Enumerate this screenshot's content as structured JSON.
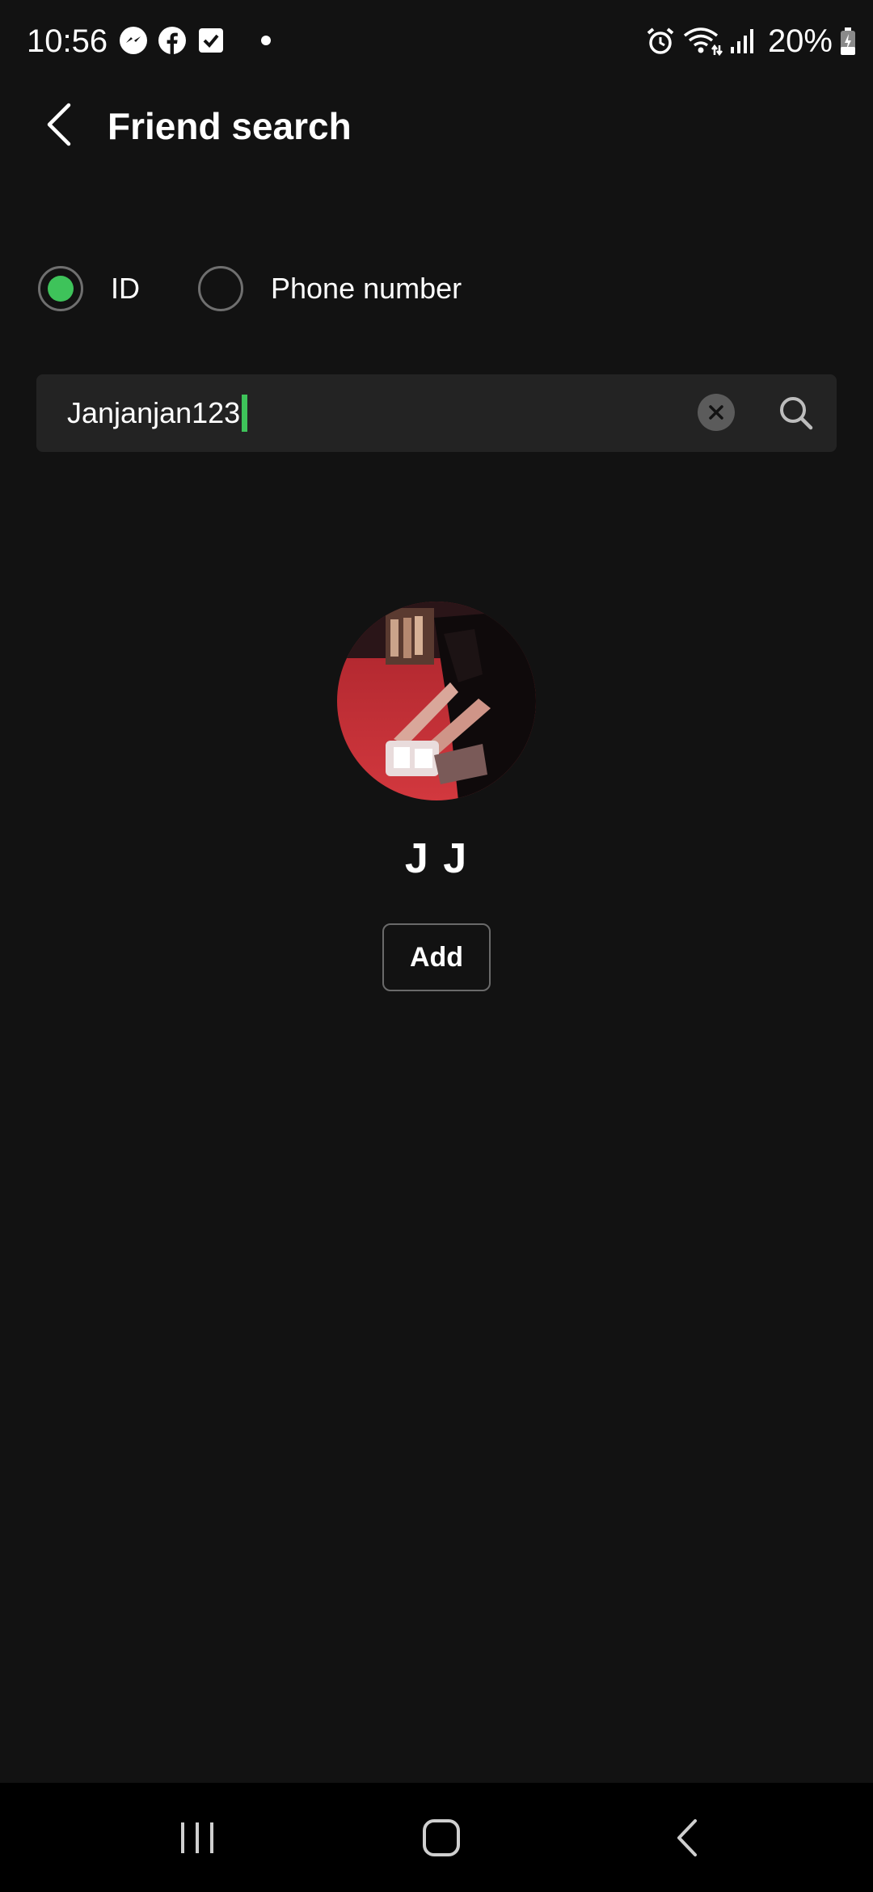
{
  "status_bar": {
    "time": "10:56",
    "left_icons": [
      "messenger-icon",
      "facebook-icon",
      "check-box-icon",
      "notification-dot-icon"
    ],
    "right_icons": [
      "alarm-icon",
      "wifi-icon",
      "signal-icon",
      "battery-charging-icon"
    ],
    "battery": "20%"
  },
  "header": {
    "title": "Friend search",
    "back_icon": "chevron-left-icon"
  },
  "search_type": {
    "options": [
      {
        "label": "ID",
        "selected": true
      },
      {
        "label": "Phone number",
        "selected": false
      }
    ],
    "accent_color": "#3ec35a"
  },
  "search": {
    "value": "Janjanjan123",
    "clear_icon": "clear-icon",
    "search_icon": "search-icon"
  },
  "result": {
    "name": "J J",
    "add_label": "Add"
  },
  "nav_bar": {
    "buttons": [
      "recents-icon",
      "home-icon",
      "back-icon"
    ]
  },
  "colors": {
    "background": "#121212",
    "field_background": "#232323",
    "accent": "#3ec35a"
  }
}
